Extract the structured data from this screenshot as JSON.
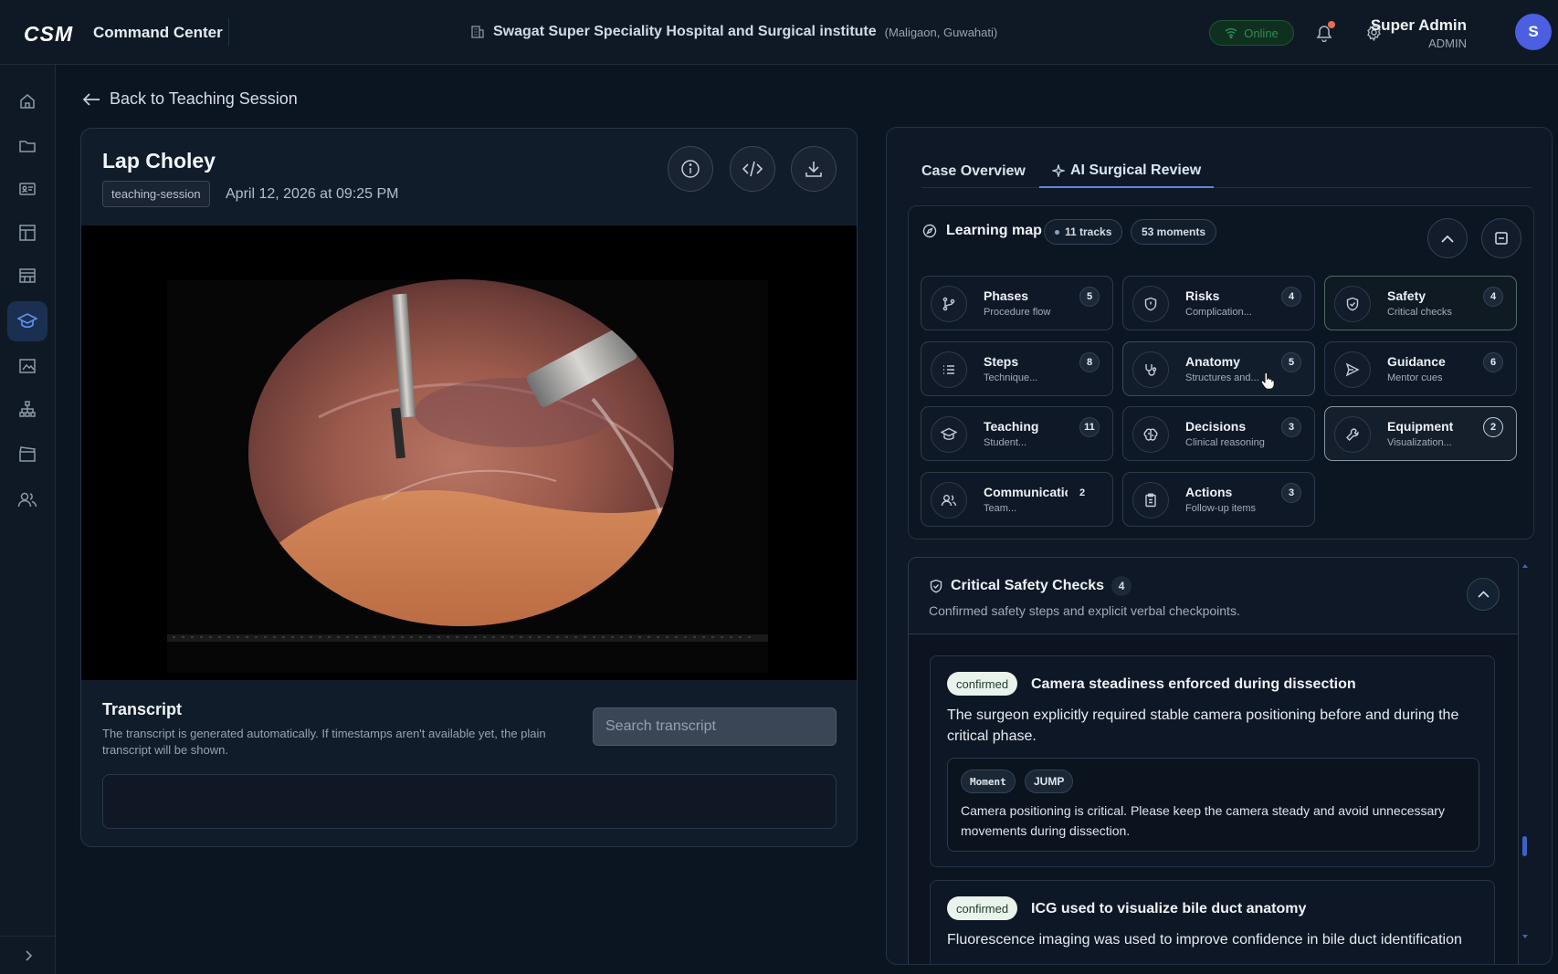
{
  "header": {
    "logo": "CSM",
    "app_name": "Command Center",
    "hospital": "Swagat Super Speciality Hospital and Surgical institute",
    "location": "(Maligaon, Guwahati)",
    "status": "Online",
    "user_name": "Super Admin",
    "user_role": "ADMIN",
    "avatar_initial": "S"
  },
  "sidebar": {
    "items": [
      {
        "icon": "home-icon"
      },
      {
        "icon": "folder-icon"
      },
      {
        "icon": "id-card-icon"
      },
      {
        "icon": "layout-icon"
      },
      {
        "icon": "table-icon"
      },
      {
        "icon": "graduation-cap-icon",
        "active": true
      },
      {
        "icon": "media-icon"
      },
      {
        "icon": "hierarchy-icon"
      },
      {
        "icon": "clapperboard-icon"
      },
      {
        "icon": "users-icon"
      }
    ]
  },
  "back_link": "Back to Teaching Session",
  "video": {
    "title": "Lap Choley",
    "tag": "teaching-session",
    "date": "April 12, 2026 at 09:25 PM",
    "actions": [
      "info-icon",
      "code-icon",
      "download-icon"
    ]
  },
  "transcript": {
    "title": "Transcript",
    "description": "The transcript is generated automatically. If timestamps aren't available yet, the plain transcript will be shown.",
    "search_placeholder": "Search transcript",
    "search_value": ""
  },
  "tabs": [
    {
      "label": "Case Overview",
      "active": false
    },
    {
      "label": "AI Surgical Review",
      "active": true
    }
  ],
  "learning_map": {
    "title": "Learning map",
    "tracks_label": "11 tracks",
    "moments_label": "53 moments",
    "tracks": [
      {
        "name": "Phases",
        "sub": "Procedure flow",
        "count": "5",
        "icon": "branch-icon"
      },
      {
        "name": "Risks",
        "sub": "Complication...",
        "count": "4",
        "icon": "shield-icon"
      },
      {
        "name": "Safety",
        "sub": "Critical checks",
        "count": "4",
        "icon": "shield-check-icon",
        "state": "highlighted"
      },
      {
        "name": "Steps",
        "sub": "Technique...",
        "count": "8",
        "icon": "list-icon"
      },
      {
        "name": "Anatomy",
        "sub": "Structures and...",
        "count": "5",
        "icon": "stethoscope-icon",
        "state": "hovered"
      },
      {
        "name": "Guidance",
        "sub": "Mentor cues",
        "count": "6",
        "icon": "send-icon"
      },
      {
        "name": "Teaching",
        "sub": "Student...",
        "count": "11",
        "icon": "graduation-cap-icon"
      },
      {
        "name": "Decisions",
        "sub": "Clinical reasoning",
        "count": "3",
        "icon": "brain-icon"
      },
      {
        "name": "Equipment",
        "sub": "Visualization...",
        "count": "2",
        "icon": "wrench-icon",
        "state": "selected"
      },
      {
        "name": "Communication",
        "sub": "Team...",
        "count": "2",
        "icon": "users-icon"
      },
      {
        "name": "Actions",
        "sub": "Follow-up items",
        "count": "3",
        "icon": "clipboard-icon"
      }
    ]
  },
  "safety": {
    "title": "Critical Safety Checks",
    "count": "4",
    "description": "Confirmed safety steps and explicit verbal checkpoints.",
    "items": [
      {
        "status": "confirmed",
        "title": "Camera steadiness enforced during dissection",
        "description": "The surgeon explicitly required stable camera positioning before and during the critical phase.",
        "moment_label": "Moment",
        "jump_label": "JUMP",
        "moment_text": "Camera positioning is critical. Please keep the camera steady and avoid unnecessary movements during dissection."
      },
      {
        "status": "confirmed",
        "title": "ICG used to visualize bile duct anatomy",
        "description": "Fluorescence imaging was used to improve confidence in bile duct identification"
      }
    ]
  },
  "colors": {
    "background": "#0b1522",
    "accent": "#5d86d8",
    "online": "#2f8a57",
    "avatar": "#4b5fe0",
    "confirmed_badge": "#eaf2ec"
  }
}
